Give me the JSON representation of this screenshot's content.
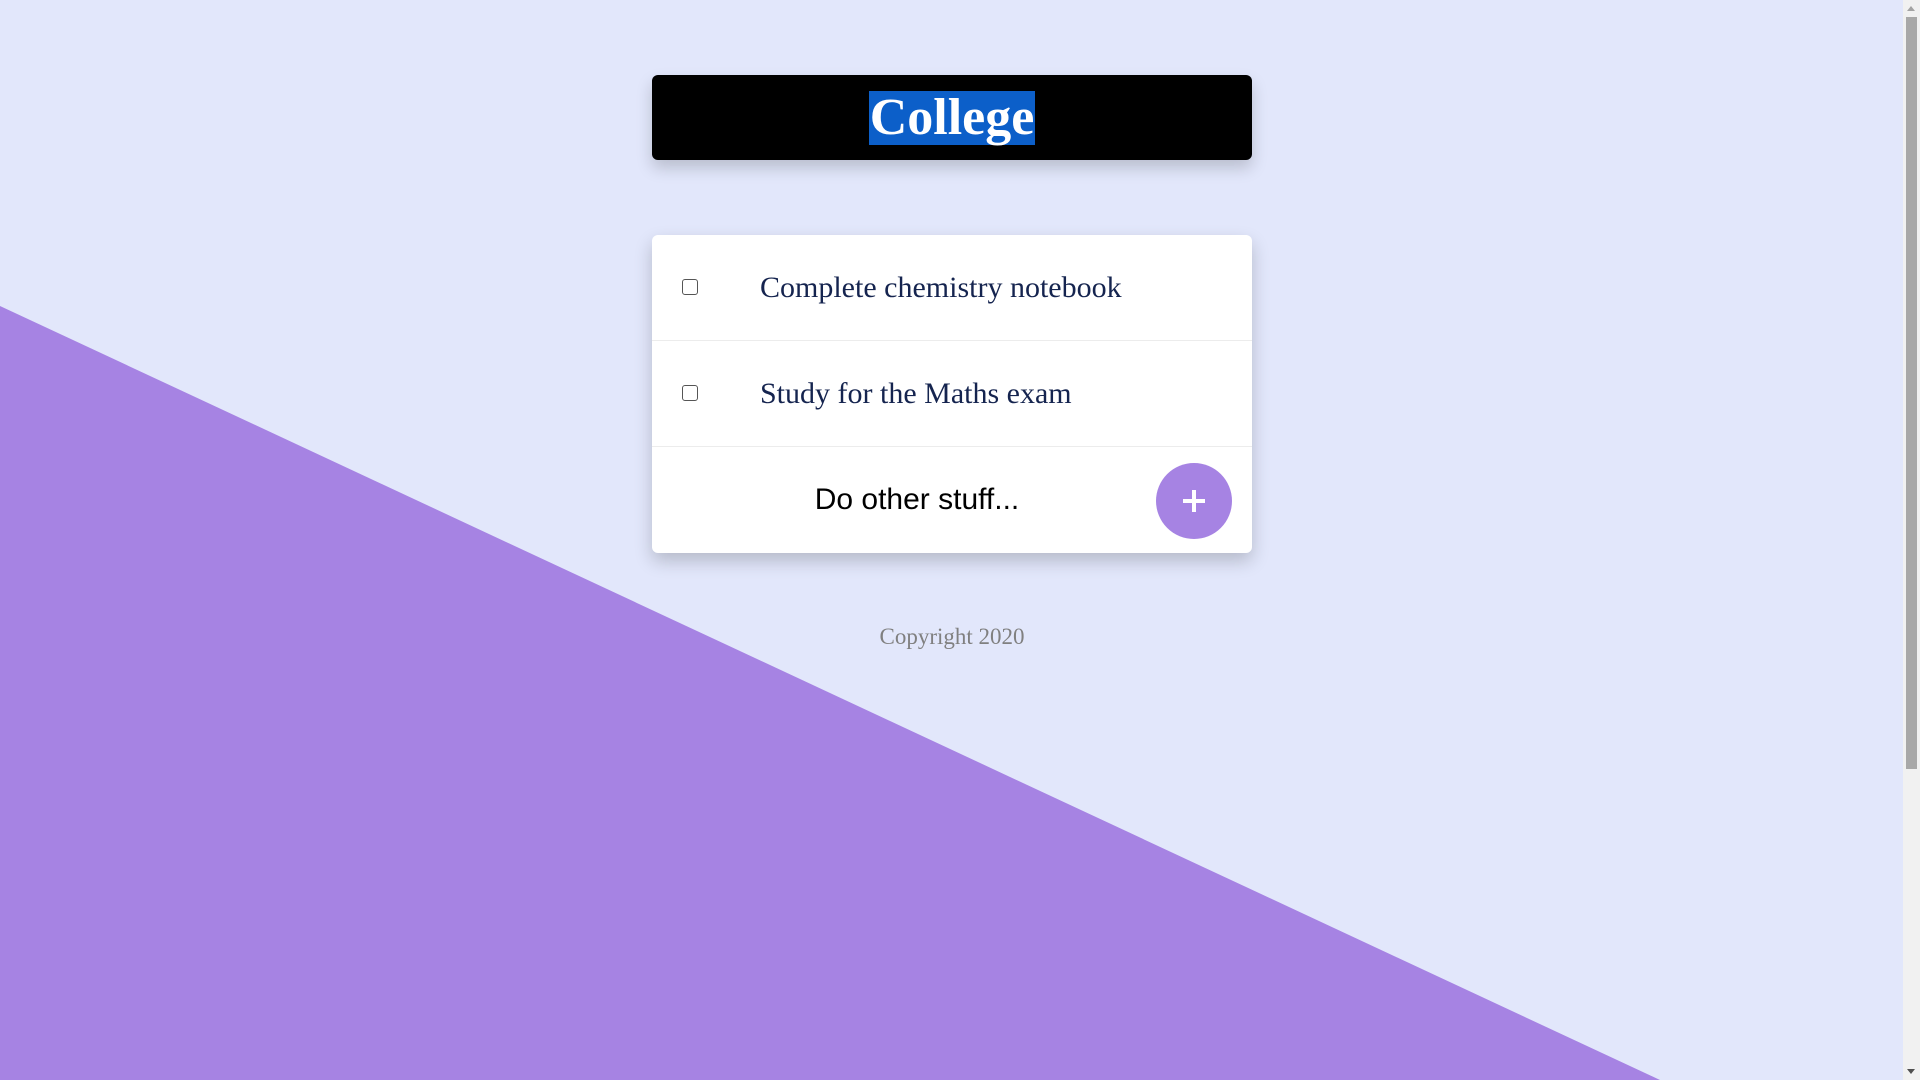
{
  "colors": {
    "background": "#e2e7fb",
    "accent": "#a683e3",
    "heading_background": "#000000",
    "title_highlight": "#0c5fc9",
    "item_text": "#15244f",
    "footer_text": "#808080"
  },
  "heading": {
    "title": "College"
  },
  "todo": {
    "items": [
      {
        "label": "Complete chemistry notebook",
        "checked": false
      },
      {
        "label": "Study for the Maths exam",
        "checked": false
      }
    ],
    "new_item": {
      "placeholder": "Do other stuff...",
      "value": "",
      "add_icon": "plus-icon"
    }
  },
  "footer": {
    "copyright": "Copyright 2020"
  }
}
